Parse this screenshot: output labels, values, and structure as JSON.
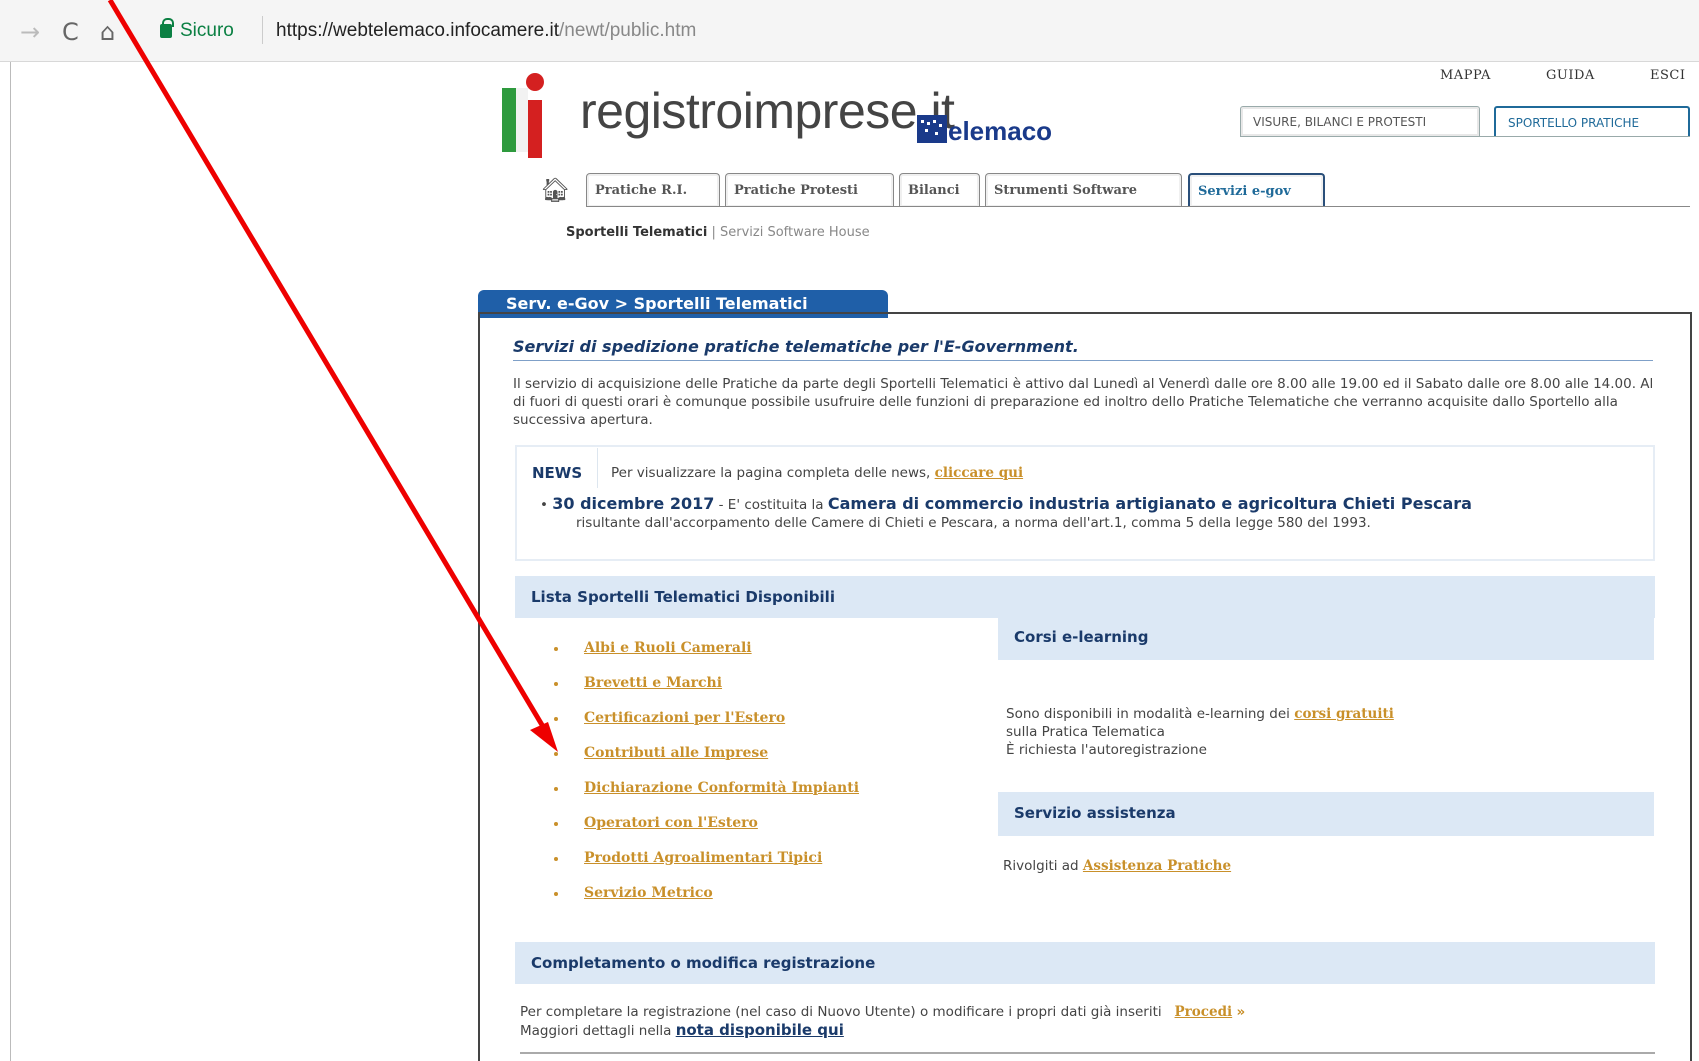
{
  "browser": {
    "back_icon": "→",
    "reload_icon": "C",
    "home_icon": "⌂",
    "secure_label": "Sicuro",
    "url_host": "https://webtelemaco.infocamere.it",
    "url_path": "/newt/public.htm"
  },
  "header": {
    "logo_text": "registroimprese.it",
    "telemaco_text": "elemaco",
    "top_links": [
      "MAPPA",
      "GUIDA",
      "ESCI"
    ],
    "right_tabs": [
      "VISURE, BILANCI E PROTESTI",
      "SPORTELLO PRATICHE"
    ]
  },
  "nav": {
    "tabs": [
      "Pratiche R.I.",
      "Pratiche Protesti",
      "Bilanci",
      "Strumenti Software",
      "Servizi e-gov"
    ],
    "active_tab": "Servizi e-gov",
    "subnav_active": "Sportelli Telematici",
    "subnav_separator": "|",
    "subnav_other": "Servizi Software House"
  },
  "section": {
    "tab_label": "Serv. e-Gov > Sportelli Telematici",
    "title": "Servizi di spedizione pratiche telematiche per l'E-Government.",
    "intro": "Il servizio di acquisizione delle Pratiche da parte degli Sportelli Telematici è attivo dal Lunedì al Venerdì dalle ore 8.00 alle 19.00 ed il Sabato dalle ore 8.00 alle 14.00. Al di fuori di questi orari è comunque possibile usufruire delle funzioni di preparazione ed inoltro dello Pratiche Telematiche che verranno acquisite dallo Sportello alla successiva apertura."
  },
  "news": {
    "label": "NEWS",
    "intro": "Per visualizzare la pagina completa delle news,",
    "link": "cliccare qui",
    "item_date": "30 dicembre 2017",
    "item_dash": " - E' costituita la ",
    "item_strong": "Camera di commercio industria artigianato e agricoltura Chieti Pescara",
    "item_rest": "risultante dall'accorpamento delle Camere di Chieti e Pescara, a norma dell'art.1, comma 5 della legge 580 del 1993."
  },
  "lista": {
    "title": "Lista Sportelli Telematici Disponibili",
    "items": [
      "Albi e Ruoli Camerali",
      "Brevetti e Marchi",
      "Certificazioni per l'Estero",
      "Contributi alle Imprese",
      "Dichiarazione Conformità Impianti",
      "Operatori con l'Estero",
      "Prodotti Agroalimentari Tipici",
      "Servizio Metrico"
    ]
  },
  "corsi": {
    "title": "Corsi e-learning",
    "line1_pre": "Sono disponibili in modalità e-learning dei ",
    "line1_link": "corsi gratuiti",
    "line2": "sulla Pratica Telematica",
    "line3": "È richiesta l'autoregistrazione"
  },
  "assistenza": {
    "title": "Servizio assistenza",
    "pre": "Rivolgiti ad ",
    "link": "Assistenza Pratiche"
  },
  "completamento": {
    "title": "Completamento o modifica registrazione",
    "line1": "Per completare la registrazione (nel caso di Nuovo Utente) o modificare i propri dati già inseriti",
    "procedi": "Procedi",
    "raquo": "»",
    "line2_pre": "Maggiori dettagli nella ",
    "line2_link": "nota disponibile qui"
  },
  "colors": {
    "accent_blue": "#1f5fa8",
    "link_orange": "#c9902a",
    "heading_navy": "#1a3a6a",
    "bar_bg": "#dce8f5",
    "annotation_red": "#ee0000"
  }
}
